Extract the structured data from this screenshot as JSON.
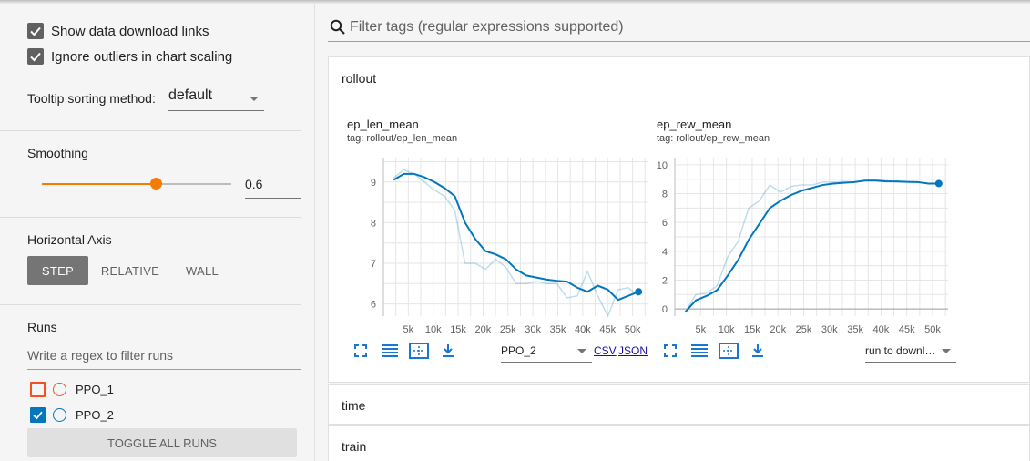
{
  "sidebar": {
    "show_download_links": {
      "label": "Show data download links",
      "checked": true
    },
    "ignore_outliers": {
      "label": "Ignore outliers in chart scaling",
      "checked": true
    },
    "tooltip": {
      "label": "Tooltip sorting method:",
      "value": "default"
    },
    "smoothing": {
      "label": "Smoothing",
      "value": "0.6",
      "fraction": 0.6
    },
    "horizontal_axis": {
      "label": "Horizontal Axis",
      "options": [
        "STEP",
        "RELATIVE",
        "WALL"
      ],
      "selected": "STEP"
    },
    "runs": {
      "label": "Runs",
      "filter_placeholder": "Write a regex to filter runs",
      "items": [
        {
          "name": "PPO_1",
          "checked": false,
          "color": "#f4511e"
        },
        {
          "name": "PPO_2",
          "checked": true,
          "color": "#0277bd"
        }
      ],
      "toggle_label": "TOGGLE ALL RUNS"
    }
  },
  "search": {
    "placeholder": "Filter tags (regular expressions supported)"
  },
  "groups": {
    "rollout": "rollout",
    "time": "time",
    "train": "train"
  },
  "charts": {
    "ep_len": {
      "title": "ep_len_mean",
      "tag": "tag: rollout/ep_len_mean",
      "run_select": "PPO_2",
      "csv_label": "CSV",
      "json_label": "JSON"
    },
    "ep_rew": {
      "title": "ep_rew_mean",
      "tag": "tag: rollout/ep_rew_mean",
      "run_select": "run to downl…"
    }
  },
  "chart_data": [
    {
      "type": "line",
      "title": "ep_len_mean",
      "xlabel": "",
      "ylabel": "",
      "xlim": [
        0,
        53000
      ],
      "ylim": [
        5.7,
        9.6
      ],
      "x_ticks": [
        "5k",
        "10k",
        "15k",
        "20k",
        "25k",
        "30k",
        "35k",
        "40k",
        "45k",
        "50k"
      ],
      "y_ticks": [
        "6",
        "7",
        "8",
        "9"
      ],
      "series": [
        {
          "name": "PPO_2",
          "color": "#0277bd",
          "x": [
            2048,
            4096,
            6144,
            8192,
            10240,
            12288,
            14336,
            16384,
            18432,
            20480,
            22528,
            24576,
            26624,
            28672,
            30720,
            32768,
            34816,
            36864,
            38912,
            40960,
            43008,
            45056,
            47104,
            49152,
            51200
          ],
          "smoothed": [
            9.05,
            9.2,
            9.2,
            9.12,
            9.0,
            8.85,
            8.65,
            8.0,
            7.6,
            7.3,
            7.22,
            7.1,
            6.85,
            6.7,
            6.65,
            6.6,
            6.57,
            6.55,
            6.4,
            6.3,
            6.45,
            6.35,
            6.1,
            6.2,
            6.3
          ],
          "raw": [
            9.1,
            9.3,
            9.2,
            9.0,
            8.8,
            8.65,
            8.3,
            7.0,
            7.0,
            6.85,
            7.1,
            6.9,
            6.5,
            6.5,
            6.55,
            6.5,
            6.5,
            6.15,
            6.2,
            6.8,
            6.2,
            5.7,
            6.35,
            6.4,
            6.2
          ]
        }
      ]
    },
    {
      "type": "line",
      "title": "ep_rew_mean",
      "xlabel": "",
      "ylabel": "",
      "xlim": [
        0,
        53000
      ],
      "ylim": [
        -0.5,
        10.5
      ],
      "x_ticks": [
        "5k",
        "10k",
        "15k",
        "20k",
        "25k",
        "30k",
        "35k",
        "40k",
        "45k",
        "50k"
      ],
      "y_ticks": [
        "0",
        "2",
        "4",
        "6",
        "8",
        "10"
      ],
      "series": [
        {
          "name": "PPO_2",
          "color": "#0277bd",
          "x": [
            2048,
            4096,
            6144,
            8192,
            10240,
            12288,
            14336,
            16384,
            18432,
            20480,
            22528,
            24576,
            26624,
            28672,
            30720,
            32768,
            34816,
            36864,
            38912,
            40960,
            43008,
            45056,
            47104,
            49152,
            51200
          ],
          "smoothed": [
            -0.2,
            0.6,
            0.9,
            1.3,
            2.3,
            3.4,
            4.8,
            5.9,
            7.0,
            7.5,
            7.9,
            8.2,
            8.4,
            8.6,
            8.7,
            8.75,
            8.8,
            8.9,
            8.9,
            8.85,
            8.85,
            8.82,
            8.8,
            8.7,
            8.7
          ],
          "raw": [
            -0.2,
            1.0,
            1.1,
            1.6,
            3.6,
            4.7,
            7.0,
            7.5,
            8.6,
            8.1,
            8.5,
            8.6,
            8.6,
            8.8,
            8.8,
            8.85,
            8.8,
            8.9,
            9.0,
            8.9,
            8.8,
            8.8,
            8.8,
            8.7,
            8.7
          ]
        }
      ]
    }
  ]
}
